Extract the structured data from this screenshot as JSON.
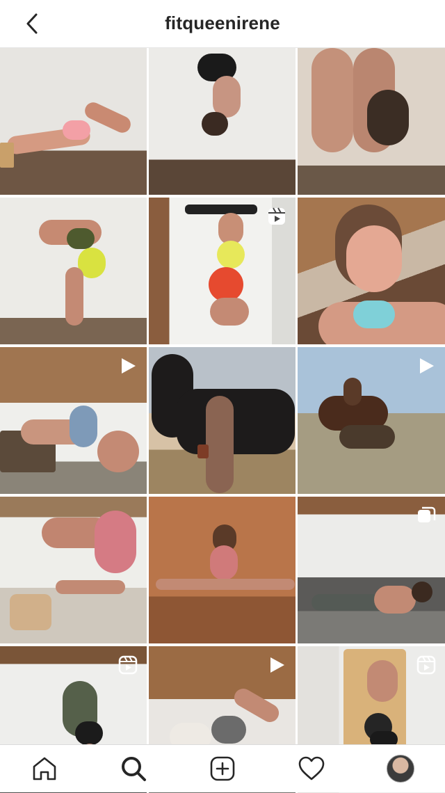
{
  "header": {
    "title": "fitqueenirene",
    "back_icon": "chevron-left-icon"
  },
  "grid": {
    "posts": [
      {
        "id": "post-1",
        "badge": "none"
      },
      {
        "id": "post-2",
        "badge": "none"
      },
      {
        "id": "post-3",
        "badge": "none"
      },
      {
        "id": "post-4",
        "badge": "none"
      },
      {
        "id": "post-5",
        "badge": "reel-icon"
      },
      {
        "id": "post-6",
        "badge": "none"
      },
      {
        "id": "post-7",
        "badge": "play-icon"
      },
      {
        "id": "post-8",
        "badge": "none"
      },
      {
        "id": "post-9",
        "badge": "play-icon"
      },
      {
        "id": "post-10",
        "badge": "none"
      },
      {
        "id": "post-11",
        "badge": "none"
      },
      {
        "id": "post-12",
        "badge": "carousel-icon"
      },
      {
        "id": "post-13",
        "badge": "reel-icon"
      },
      {
        "id": "post-14",
        "badge": "play-icon"
      },
      {
        "id": "post-15",
        "badge": "reel-icon"
      }
    ]
  },
  "bottom_nav": {
    "items": [
      "home-icon",
      "search-icon",
      "new-post-icon",
      "activity-heart-icon",
      "profile-avatar"
    ]
  },
  "colors": {
    "text": "#262626",
    "divider": "#dbdbdb",
    "background": "#ffffff"
  }
}
